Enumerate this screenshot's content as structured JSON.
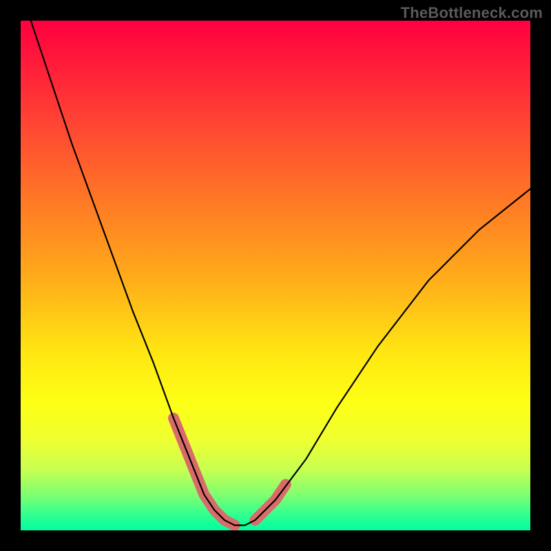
{
  "watermark": "TheBottleneck.com",
  "chart_data": {
    "type": "line",
    "title": "",
    "xlabel": "",
    "ylabel": "",
    "xlim": [
      0,
      100
    ],
    "ylim": [
      0,
      100
    ],
    "series": [
      {
        "name": "bottleneck-curve",
        "x": [
          2,
          6,
          10,
          14,
          18,
          22,
          26,
          30,
          32,
          34,
          36,
          38,
          40,
          42,
          44,
          46,
          50,
          56,
          62,
          70,
          80,
          90,
          100
        ],
        "y": [
          100,
          88,
          76,
          65,
          54,
          43,
          33,
          22,
          17,
          12,
          7,
          4,
          2,
          1,
          1,
          2,
          6,
          14,
          24,
          36,
          49,
          59,
          67
        ]
      },
      {
        "name": "highlight-band-left",
        "x": [
          30,
          32,
          34,
          36,
          38,
          40,
          42
        ],
        "y": [
          22,
          17,
          12,
          7,
          4,
          2,
          1
        ]
      },
      {
        "name": "highlight-band-right",
        "x": [
          46,
          48,
          50,
          52
        ],
        "y": [
          2,
          4,
          6,
          9
        ]
      }
    ],
    "colors": {
      "curve": "#000000",
      "highlight": "#d96b6b"
    },
    "stroke_width": {
      "curve": 2.2,
      "highlight": 16
    }
  }
}
